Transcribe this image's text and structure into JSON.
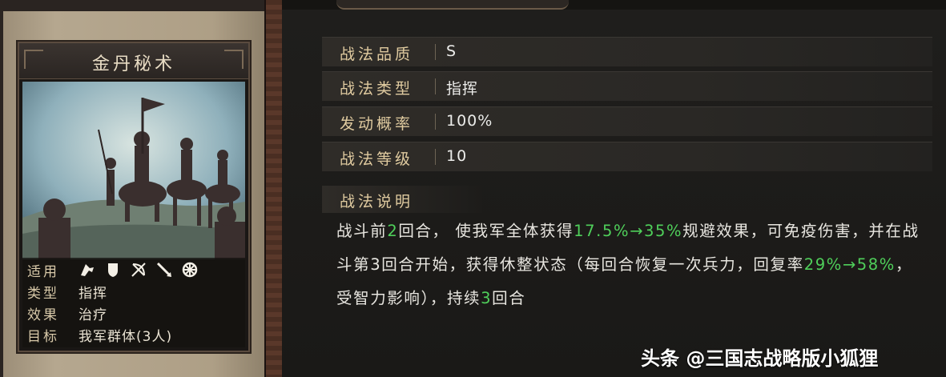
{
  "card": {
    "title": "金丹秘术",
    "info": [
      {
        "label": "适用",
        "value": ""
      },
      {
        "label": "类型",
        "value": "指挥"
      },
      {
        "label": "效果",
        "value": "治疗"
      },
      {
        "label": "目标",
        "value": "我军群体(3人)"
      }
    ],
    "troop_icons": [
      "cavalry-icon",
      "shield-icon",
      "bow-icon",
      "spear-icon",
      "wheel-icon"
    ]
  },
  "stats": [
    {
      "label": "战法品质",
      "value": "S"
    },
    {
      "label": "战法类型",
      "value": "指挥"
    },
    {
      "label": "发动概率",
      "value": "100%"
    },
    {
      "label": "战法等级",
      "value": "10"
    }
  ],
  "description": {
    "heading": "战法说明",
    "segments": [
      {
        "text": "战斗前",
        "highlight": false
      },
      {
        "text": "2",
        "highlight": true
      },
      {
        "text": "回合，  使我军全体获得",
        "highlight": false
      },
      {
        "text": "17.5%→35%",
        "highlight": true
      },
      {
        "text": "规避效果，可免疫伤害，并在战斗第3回合开始，获得休整状态（每回合恢复一次兵力，回复率",
        "highlight": false
      },
      {
        "text": "29%→58%",
        "highlight": true
      },
      {
        "text": "，受智力影响），持续",
        "highlight": false
      },
      {
        "text": "3",
        "highlight": true
      },
      {
        "text": "回合",
        "highlight": false
      }
    ]
  },
  "watermark": "头条 @三国志战略版小狐狸",
  "colors": {
    "highlight": "#4fcf5a",
    "label_gold": "#e0cba0"
  }
}
